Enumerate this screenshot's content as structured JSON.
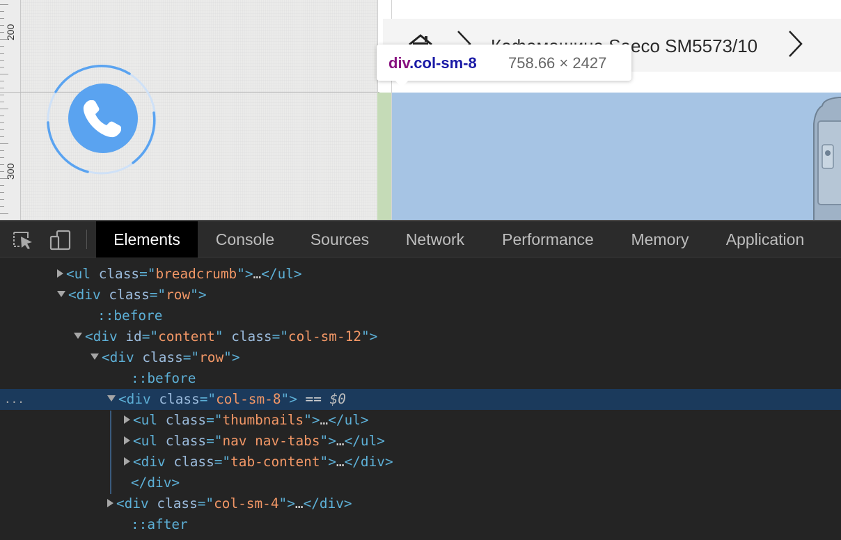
{
  "ruler": {
    "labels": [
      "200",
      "300"
    ]
  },
  "breadcrumb": {
    "product_title": "Кофемашина Saeco SM5573/10"
  },
  "tooltip": {
    "tag": "div",
    "class": ".col-sm-8",
    "size": "758.66 × 2427"
  },
  "devtools": {
    "tabs": [
      "Elements",
      "Console",
      "Sources",
      "Network",
      "Performance",
      "Memory",
      "Application"
    ],
    "active_tab": "Elements",
    "selected_ref": "== $0",
    "ellipsis": "...",
    "dom_lines": [
      {
        "arrow": "closed",
        "parts": [
          [
            "tg",
            "<ul "
          ],
          [
            "at",
            "class"
          ],
          [
            "tg",
            "=\""
          ],
          [
            "av",
            "breadcrumb"
          ],
          [
            "tg",
            "\">"
          ],
          [
            "txt",
            "…"
          ],
          [
            "tg",
            "</ul>"
          ]
        ]
      },
      {
        "arrow": "open",
        "parts": [
          [
            "tg",
            "<div "
          ],
          [
            "at",
            "class"
          ],
          [
            "tg",
            "=\""
          ],
          [
            "av",
            "row"
          ],
          [
            "tg",
            "\">"
          ]
        ]
      },
      {
        "arrow": "none",
        "parts": [
          [
            "ps",
            "::before"
          ]
        ]
      },
      {
        "arrow": "open",
        "parts": [
          [
            "tg",
            "<div "
          ],
          [
            "at",
            "id"
          ],
          [
            "tg",
            "=\""
          ],
          [
            "av",
            "content"
          ],
          [
            "tg",
            "\" "
          ],
          [
            "at",
            "class"
          ],
          [
            "tg",
            "=\""
          ],
          [
            "av",
            "col-sm-12"
          ],
          [
            "tg",
            "\">"
          ]
        ]
      },
      {
        "arrow": "open",
        "parts": [
          [
            "tg",
            "<div "
          ],
          [
            "at",
            "class"
          ],
          [
            "tg",
            "=\""
          ],
          [
            "av",
            "row"
          ],
          [
            "tg",
            "\">"
          ]
        ]
      },
      {
        "arrow": "none",
        "parts": [
          [
            "ps",
            "::before"
          ]
        ]
      },
      {
        "arrow": "open",
        "parts": [
          [
            "tg",
            "<div "
          ],
          [
            "at",
            "class"
          ],
          [
            "tg",
            "=\""
          ],
          [
            "av",
            "col-sm-8"
          ],
          [
            "tg",
            "\">"
          ],
          [
            "txt",
            " == "
          ],
          [
            "ref",
            "$0"
          ]
        ]
      },
      {
        "arrow": "closed",
        "parts": [
          [
            "tg",
            "<ul "
          ],
          [
            "at",
            "class"
          ],
          [
            "tg",
            "=\""
          ],
          [
            "av",
            "thumbnails"
          ],
          [
            "tg",
            "\">"
          ],
          [
            "txt",
            "…"
          ],
          [
            "tg",
            "</ul>"
          ]
        ]
      },
      {
        "arrow": "closed",
        "parts": [
          [
            "tg",
            "<ul "
          ],
          [
            "at",
            "class"
          ],
          [
            "tg",
            "=\""
          ],
          [
            "av",
            "nav nav-tabs"
          ],
          [
            "tg",
            "\">"
          ],
          [
            "txt",
            "…"
          ],
          [
            "tg",
            "</ul>"
          ]
        ]
      },
      {
        "arrow": "closed",
        "parts": [
          [
            "tg",
            "<div "
          ],
          [
            "at",
            "class"
          ],
          [
            "tg",
            "=\""
          ],
          [
            "av",
            "tab-content"
          ],
          [
            "tg",
            "\">"
          ],
          [
            "txt",
            "…"
          ],
          [
            "tg",
            "</div>"
          ]
        ]
      },
      {
        "arrow": "none",
        "parts": [
          [
            "tg",
            "</div>"
          ]
        ]
      },
      {
        "arrow": "closed",
        "parts": [
          [
            "tg",
            "<div "
          ],
          [
            "at",
            "class"
          ],
          [
            "tg",
            "=\""
          ],
          [
            "av",
            "col-sm-4"
          ],
          [
            "tg",
            "\">"
          ],
          [
            "txt",
            "…"
          ],
          [
            "tg",
            "</div>"
          ]
        ]
      },
      {
        "arrow": "none",
        "parts": [
          [
            "ps",
            "::after"
          ]
        ]
      }
    ]
  },
  "colors": {
    "phone_button": "#5aa3f0",
    "highlight_content": "#a6c4e4",
    "highlight_padding": "#c5dbb7",
    "selected_row": "#1b3a5c",
    "tag": "#5db0d7",
    "attr_value": "#f29766"
  },
  "icons": [
    "home-icon",
    "chevron-right-icon",
    "phone-icon",
    "inspect-element-icon",
    "device-toolbar-icon"
  ]
}
